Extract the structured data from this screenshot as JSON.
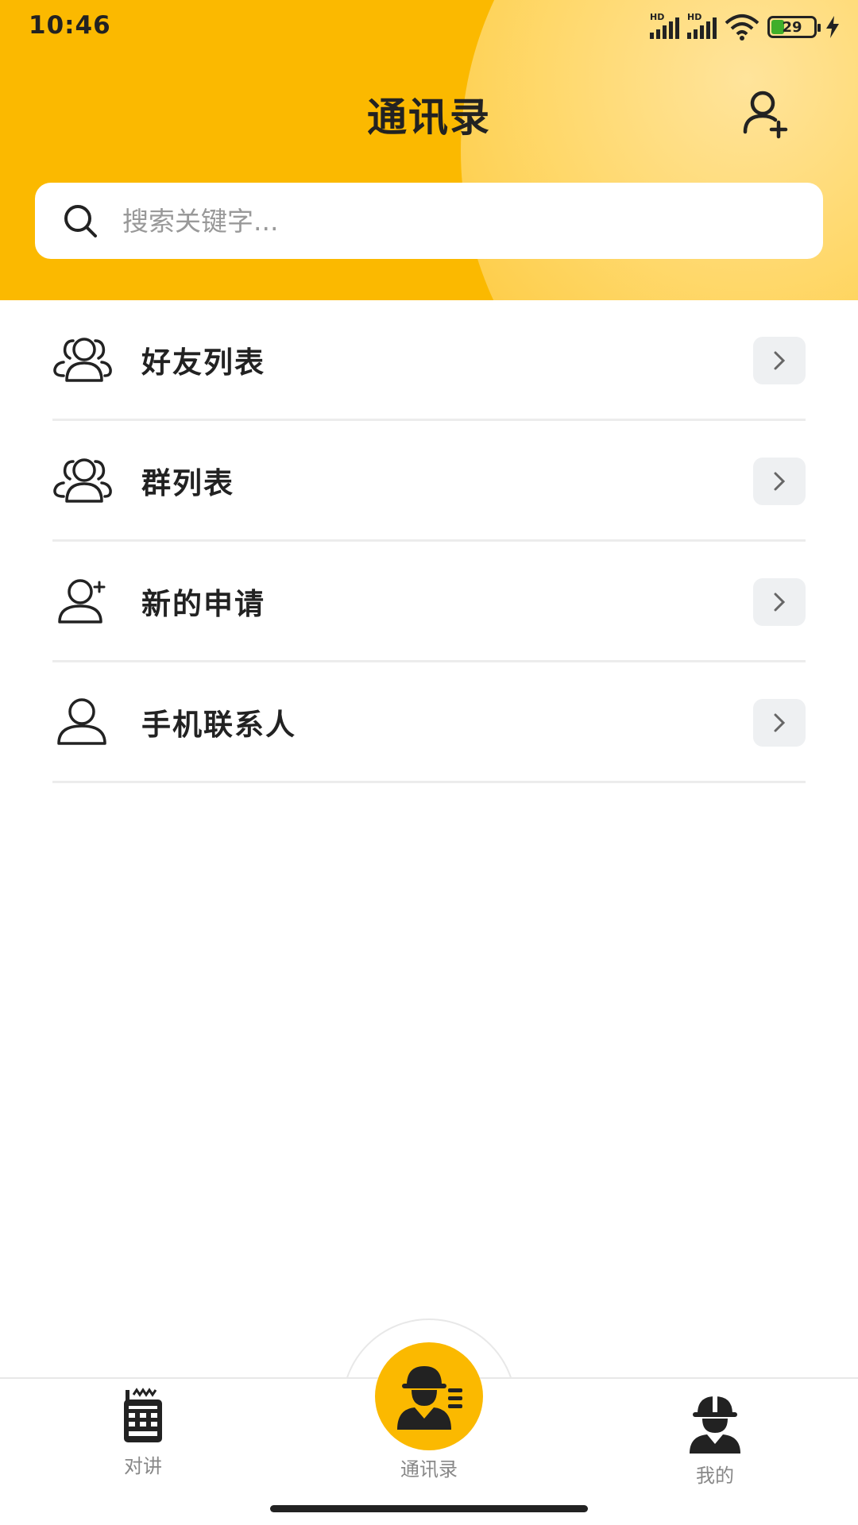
{
  "status_bar": {
    "time": "10:46",
    "signal_1_label": "HD",
    "signal_2_label": "HD",
    "battery_level": "29",
    "icons": [
      "signal-icon",
      "signal-icon",
      "wifi-icon",
      "battery-icon",
      "charging-icon"
    ]
  },
  "header": {
    "title": "通讯录",
    "add_icon": "person-add-icon",
    "accent_color": "#FBB900"
  },
  "search": {
    "placeholder": "搜索关键字...",
    "value": ""
  },
  "list": {
    "items": [
      {
        "label": "好友列表",
        "icon": "friends-icon"
      },
      {
        "label": "群列表",
        "icon": "group-icon"
      },
      {
        "label": "新的申请",
        "icon": "new-request-icon"
      },
      {
        "label": "手机联系人",
        "icon": "phone-contact-icon"
      }
    ]
  },
  "bottom_nav": {
    "items": [
      {
        "label": "对讲",
        "icon": "walkie-talkie-icon"
      },
      {
        "label": "通讯录",
        "icon": "worker-contacts-icon",
        "active": true
      },
      {
        "label": "我的",
        "icon": "worker-profile-icon"
      }
    ]
  }
}
